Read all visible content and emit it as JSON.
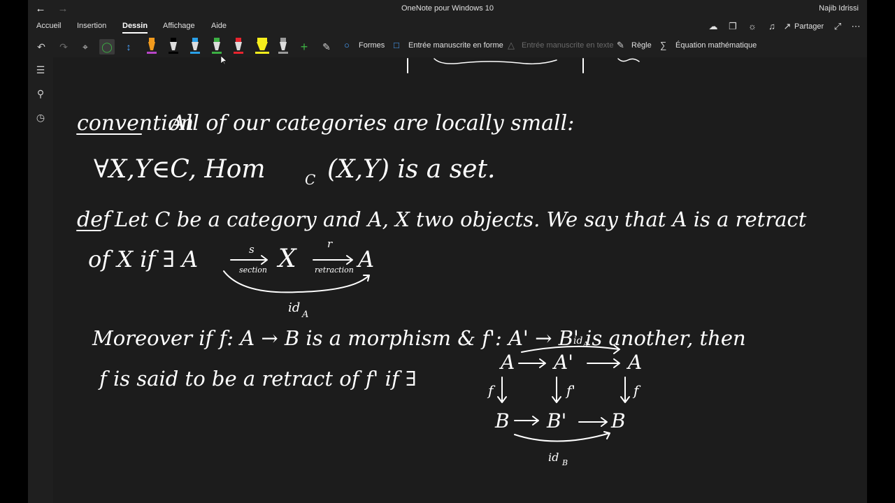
{
  "window": {
    "title": "OneNote pour Windows 10",
    "user": "Najib Idrissi"
  },
  "ribbon": {
    "tabs": [
      "Accueil",
      "Insertion",
      "Dessin",
      "Affichage",
      "Aide"
    ],
    "active_tab": "Dessin",
    "share_label": "Partager"
  },
  "toolbar": {
    "shapes_label": "Formes",
    "ink_to_shape_label": "Entrée manuscrite en forme",
    "ink_to_text_label": "Entrée manuscrite en texte",
    "ruler_label": "Règle",
    "math_label": "Équation mathématique",
    "pens": [
      {
        "name": "highlighter-orange",
        "color": "#f29b1d"
      },
      {
        "name": "pen-black",
        "color": "#000000"
      },
      {
        "name": "pen-blue",
        "color": "#2aa0e8"
      },
      {
        "name": "pen-green",
        "color": "#3cb043"
      },
      {
        "name": "pen-red",
        "color": "#e8242e"
      },
      {
        "name": "highlighter-yellow",
        "color": "#f6ee1c"
      },
      {
        "name": "pen-gray",
        "color": "#9a9a9a"
      }
    ]
  },
  "note": {
    "line1_label": "convention",
    "line1_text": "All of our categories are locally small:",
    "line2_text": "∀X,Y∈C, Hom",
    "line2_sub": "C",
    "line2_rest": "(X,Y) is a set.",
    "line3_label": "def",
    "line3_text": "Let C be a category and A, X two objects. We say that A is a retract",
    "line4_text": "of X if ∃ A",
    "line4_arrow1_top": "s",
    "line4_arrow1_bottom": "section",
    "line4_mid": "X",
    "line4_arrow2_top": "r",
    "line4_arrow2_bottom": "retraction",
    "line4_end": "A",
    "line4_loop": "id",
    "line4_loop_sub": "A",
    "line5_text": "Moreover if f: A → B is a morphism & f': A' → B' is another, then",
    "line6_text": "f is said to be a retract of f' if ∃",
    "diagram": {
      "top_row": [
        "A",
        "A'",
        "A"
      ],
      "bottom_row": [
        "B",
        "B'",
        "B"
      ],
      "vert_labels": [
        "f",
        "f'",
        "f"
      ],
      "top_loop": "id",
      "top_loop_sub": "A",
      "bottom_loop": "id",
      "bottom_loop_sub": "B"
    }
  },
  "colors": {
    "canvas": "#1c1c1c",
    "chrome": "#1f1f1f",
    "ink": "#ffffff",
    "accent": "#4aa3ff"
  }
}
